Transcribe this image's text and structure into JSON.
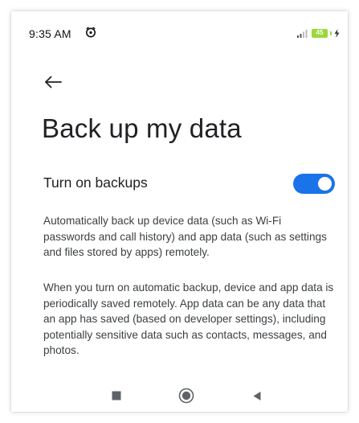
{
  "status_bar": {
    "time": "9:35 AM",
    "battery_level": "45"
  },
  "icons": {
    "alarm": "alarm-icon",
    "signal": "signal-icon",
    "battery": "battery-icon",
    "charging": "charging-icon",
    "back": "back-arrow-icon",
    "recents": "square-icon",
    "home": "circle-icon",
    "nav_back": "triangle-icon"
  },
  "page": {
    "title": "Back up my data"
  },
  "setting": {
    "label": "Turn on backups",
    "enabled": true
  },
  "description": {
    "paragraph_1": "Automatically back up device data (such as Wi-Fi passwords and call history) and app data (such as settings and files stored by apps) remotely.",
    "paragraph_2": "When you turn on automatic backup, device and app data is periodically saved remotely. App data can be any data that an app has saved (based on developer settings), including potentially sensitive data such as contacts, messages, and photos."
  },
  "colors": {
    "accent": "#1a73e8",
    "battery": "#9ad93a"
  }
}
